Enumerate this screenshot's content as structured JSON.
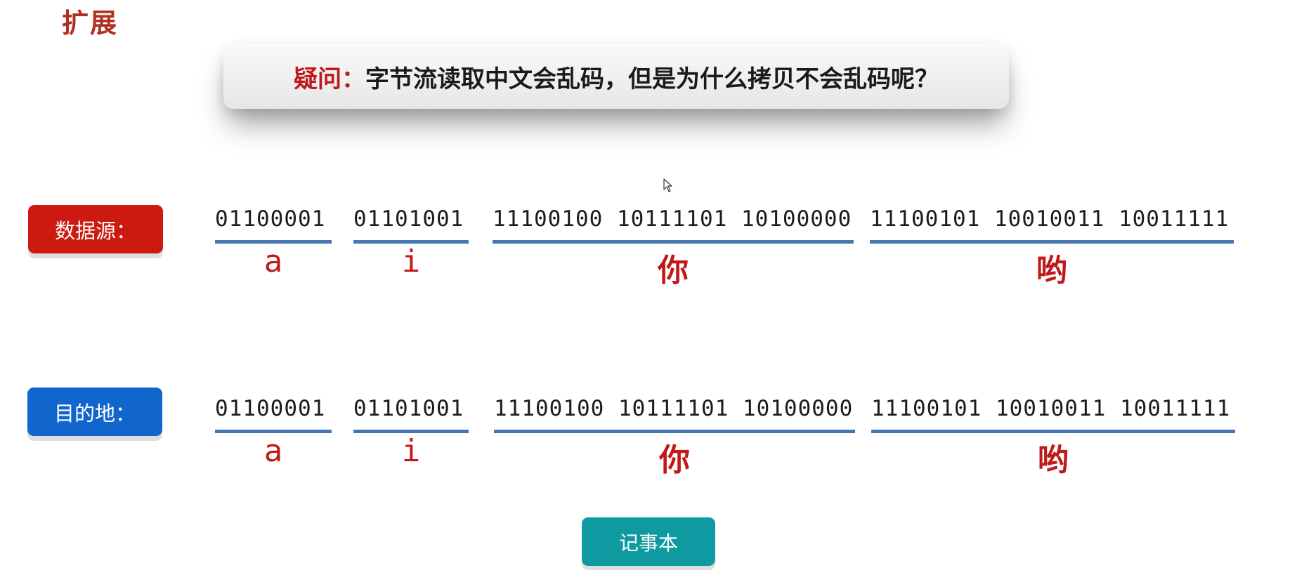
{
  "heading": "扩展",
  "question": {
    "prefix": "疑问：",
    "text": "字节流读取中文会乱码，但是为什么拷贝不会乱码呢？"
  },
  "source": {
    "label": "数据源：",
    "segments": [
      {
        "bytes": "01100001",
        "char": "a"
      },
      {
        "bytes": "01101001",
        "char": "i"
      },
      {
        "bytes": "11100100 10111101 10100000",
        "char": "你"
      },
      {
        "bytes": "11100101 10010011 10011111",
        "char": "哟"
      }
    ]
  },
  "destination": {
    "label": "目的地：",
    "segments": [
      {
        "bytes": "01100001",
        "char": "a"
      },
      {
        "bytes": "01101001",
        "char": "i"
      },
      {
        "bytes": "11100100 10111101 10100000",
        "char": "你"
      },
      {
        "bytes": "11100101 10010011 10011111",
        "char": "哟"
      }
    ]
  },
  "notepad_label": "记事本",
  "colors": {
    "accent_red": "#c0191a",
    "source_pill": "#cc1a10",
    "destination_pill": "#1066cc",
    "underline": "#4677b0",
    "notepad": "#0e9aa0"
  }
}
